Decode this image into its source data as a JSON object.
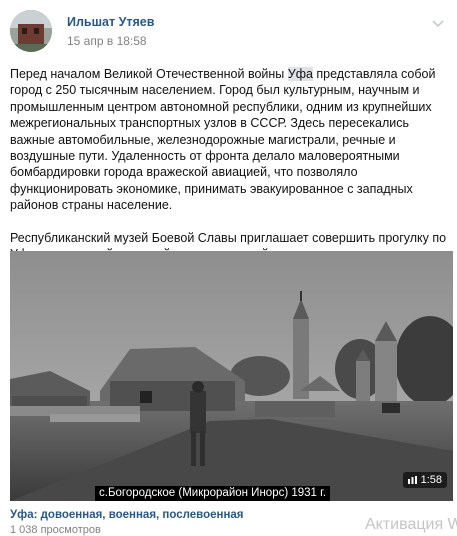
{
  "post": {
    "author": "Ильшат Утяев",
    "date": "15 апр в 18:58",
    "paragraph1_before": "Перед началом Великой Отечественной войны ",
    "paragraph1_highlight": "Уфа",
    "paragraph1_after": " представляла собой город с 250 тысячным населением. Город был культурным, научным и промышленным центром автономной республики, одним из крупнейших межрегиональных транспортных узлов в СССР. Здесь пересекались важные автомобильные, железнодорожные магистрали, речные и воздушные пути. Удаленность от фронта делало маловероятными бомбардировки города вражеской авиацией, что позволяло функционировать экономике, принимать эвакуированное с западных районов страны население.",
    "paragraph2": "Республиканский музей Боевой Славы приглашает совершить прогулку по Уфе в довоенный, военный и послевоенный период."
  },
  "video": {
    "caption": "с.Богородское (Микрорайон Инорс) 1931 г.",
    "duration": "1:58",
    "title": "Уфа: довоенная, военная, послевоенная",
    "views": "1 038 просмотров"
  },
  "overlay": {
    "activation": "Активация W"
  },
  "icons": {
    "menu": "chevron-down-icon",
    "duration": "video-bars-icon"
  },
  "colors": {
    "link": "#2a5885",
    "meta": "#828282",
    "highlight": "#dfe3e8"
  }
}
